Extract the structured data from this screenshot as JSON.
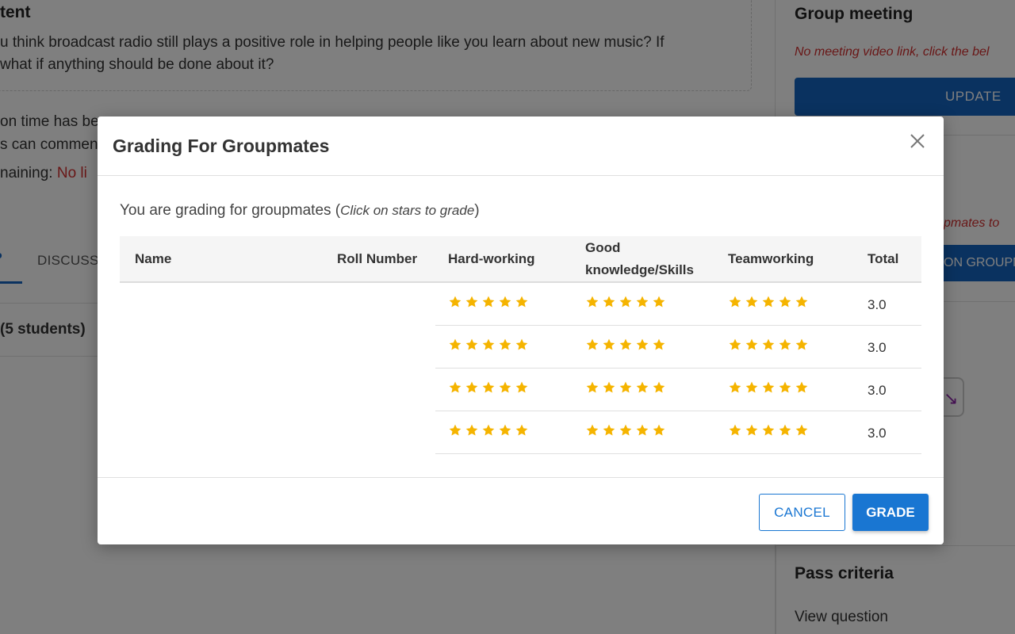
{
  "background": {
    "content_title": "tent",
    "question_line1": "u think broadcast radio still plays a positive role in helping people like you learn about new music? If",
    "question_line2": "what if anything should be done about it?",
    "status_line1": "on time has be",
    "status_line2": "s can commen",
    "status_line3_prefix": "naining:",
    "status_line3_value": "No li",
    "tab_active": "P",
    "tab_discuss": "DISCUSS",
    "students_count": "(5 students)",
    "right": {
      "group_meeting_title": "Group meeting",
      "group_meeting_note": "No meeting video link, click the bel",
      "update_button": "UPDATE",
      "groupmates_note": "pmates to",
      "groupmates_button": "ON GROUPM",
      "pass_criteria_title": "Pass criteria",
      "view_question": "View question"
    }
  },
  "modal": {
    "title": "Grading For Groupmates",
    "intro_text": "You are grading for groupmates (",
    "intro_italic": "Click on stars to grade",
    "intro_close": ")",
    "columns": {
      "name": "Name",
      "roll_number": "Roll Number",
      "hard_working": "Hard-working",
      "good_knowledge": "Good knowledge/Skills",
      "teamworking": "Teamworking",
      "total": "Total"
    },
    "rows": [
      {
        "name": "",
        "roll_number": "",
        "hard_working": 5,
        "good_knowledge": 5,
        "teamworking": 5,
        "total": "3.0"
      },
      {
        "name": "",
        "roll_number": "",
        "hard_working": 5,
        "good_knowledge": 5,
        "teamworking": 5,
        "total": "3.0"
      },
      {
        "name": "",
        "roll_number": "",
        "hard_working": 5,
        "good_knowledge": 5,
        "teamworking": 5,
        "total": "3.0"
      },
      {
        "name": "",
        "roll_number": "",
        "hard_working": 5,
        "good_knowledge": 5,
        "teamworking": 5,
        "total": "3.0"
      }
    ],
    "star_max": 5,
    "star_color": "#f5b400",
    "cancel_button": "CANCEL",
    "grade_button": "GRADE",
    "close_icon": "close-icon"
  },
  "colors": {
    "primary": "#1976d2",
    "danger": "#d32f2f",
    "overlay": "rgba(0,0,0,0.5)"
  }
}
